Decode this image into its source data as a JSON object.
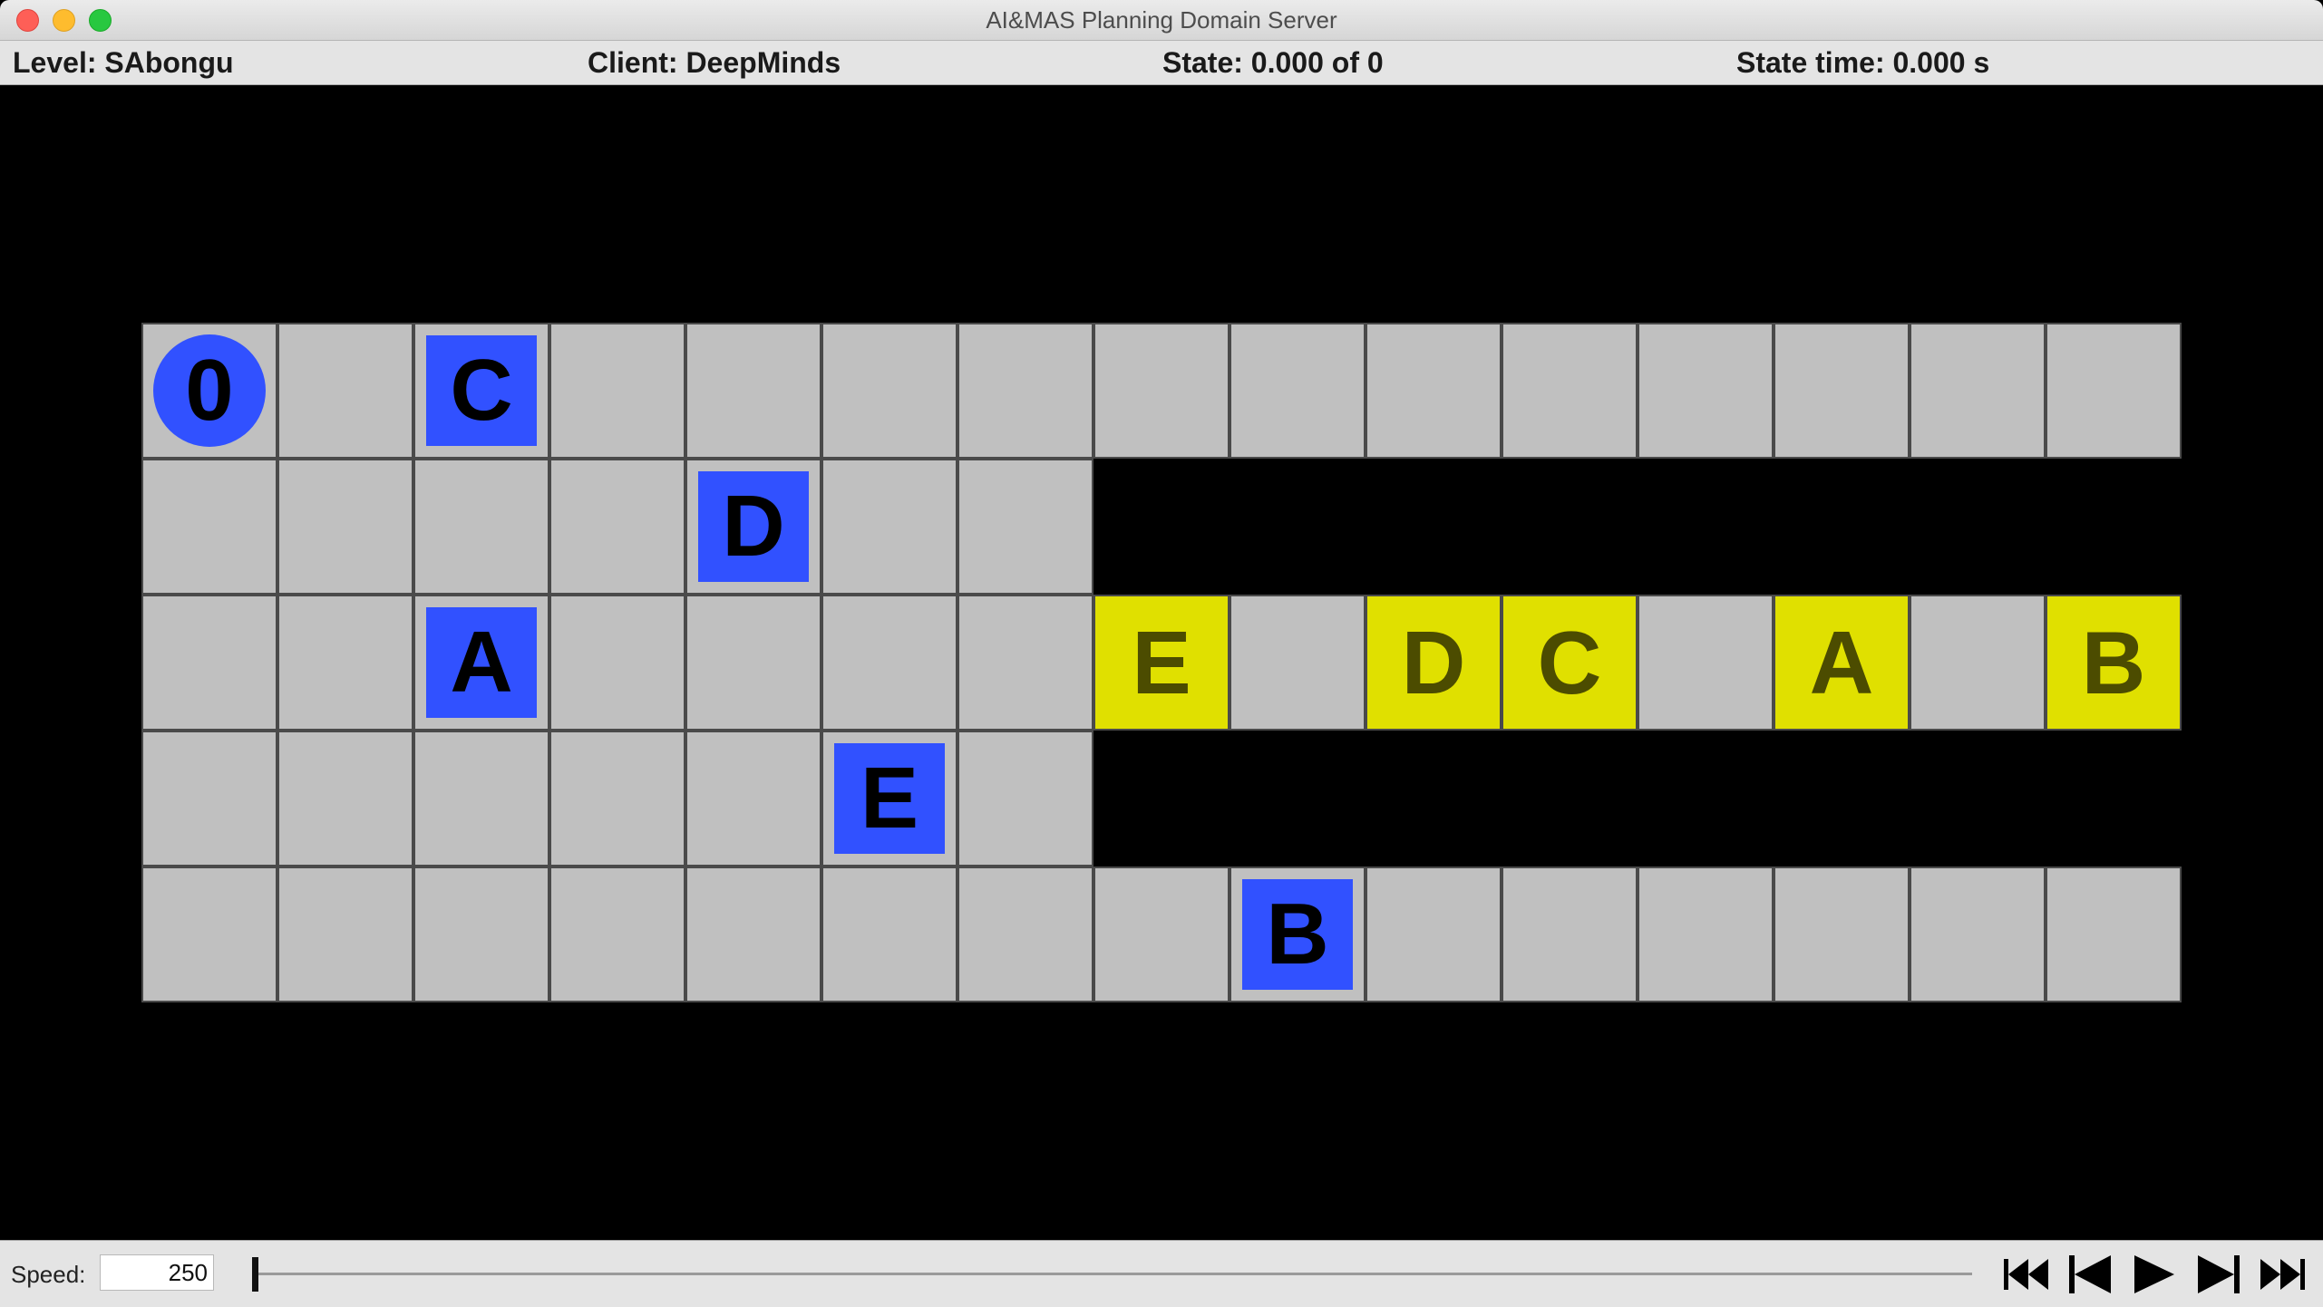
{
  "window": {
    "title": "AI&MAS Planning Domain Server"
  },
  "status": {
    "level": "Level: SAbongu",
    "client": "Client: DeepMinds",
    "state": "State: 0.000 of 0",
    "state_time": "State time: 0.000 s"
  },
  "board": {
    "rows": 5,
    "cols": 15,
    "agents": [
      {
        "label": "0",
        "row": 0,
        "col": 0,
        "color": "#3151ff"
      }
    ],
    "boxes": [
      {
        "label": "C",
        "row": 0,
        "col": 2,
        "color": "#3151ff"
      },
      {
        "label": "D",
        "row": 1,
        "col": 4,
        "color": "#3151ff"
      },
      {
        "label": "A",
        "row": 2,
        "col": 2,
        "color": "#3151ff"
      },
      {
        "label": "E",
        "row": 3,
        "col": 5,
        "color": "#3151ff"
      },
      {
        "label": "B",
        "row": 4,
        "col": 8,
        "color": "#3151ff"
      }
    ],
    "goals": [
      {
        "label": "E",
        "row": 2,
        "col": 7,
        "color": "#e0e000"
      },
      {
        "label": "D",
        "row": 2,
        "col": 9,
        "color": "#e0e000"
      },
      {
        "label": "C",
        "row": 2,
        "col": 10,
        "color": "#e0e000"
      },
      {
        "label": "A",
        "row": 2,
        "col": 12,
        "color": "#e0e000"
      },
      {
        "label": "B",
        "row": 2,
        "col": 14,
        "color": "#e0e000"
      }
    ],
    "floor_color": "#c0c0c0",
    "wall_color": "#000000"
  },
  "controls": {
    "speed_label": "Speed:",
    "speed_value": "250",
    "slider_position": 0,
    "buttons": [
      "skip-to-start-icon",
      "step-back-icon",
      "play-icon",
      "step-forward-icon",
      "skip-to-end-icon"
    ]
  }
}
